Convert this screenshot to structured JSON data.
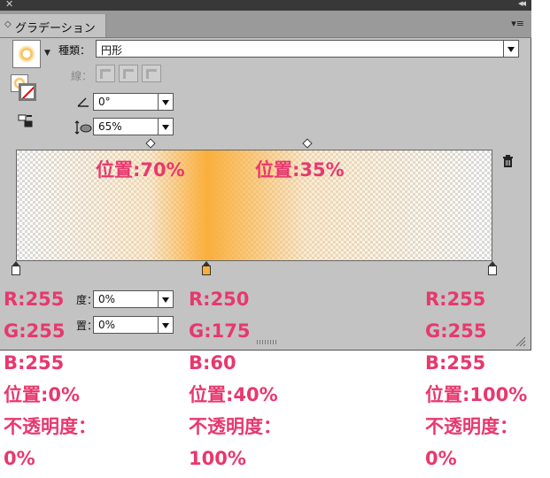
{
  "panel": {
    "tab_label": "グラデーション",
    "type_label": "種類：",
    "type_value": "円形",
    "stroke_label": "線：",
    "angle_value": "0°",
    "aspect_value": "65%",
    "opacity_label_partial": "度：",
    "opacity_value": "0%",
    "location_label_partial": "置：",
    "location_value": "0%"
  },
  "gradient": {
    "stops": [
      {
        "color": "#ffffff",
        "position": 0,
        "opacity": 0
      },
      {
        "color": "#faaf3c",
        "position": 40,
        "opacity": 100
      },
      {
        "color": "#ffffff",
        "position": 100,
        "opacity": 0
      }
    ],
    "midpoints": [
      70,
      35
    ]
  },
  "annotations": {
    "mid1": "位置:70%",
    "mid2": "位置:35%",
    "left": [
      "R:255",
      "G:255",
      "B:255",
      "位置:0%",
      "不透明度：",
      "0%"
    ],
    "center": [
      "R:250",
      "G:175",
      "B:60",
      "位置:40%",
      "不透明度：",
      "100%"
    ],
    "right": [
      "R:255",
      "G:255",
      "B:255",
      "位置:100%",
      "不透明度：",
      "0%"
    ]
  },
  "icons": [
    "close-icon",
    "collapse-icon",
    "panel-menu-icon",
    "angle-icon",
    "aspect-ratio-icon",
    "reverse-gradient-icon",
    "trash-icon"
  ],
  "colors": {
    "annotation": "#e8386e",
    "panel_bg": "#c3c3c3",
    "gradient_orange": "#faaf3c"
  }
}
